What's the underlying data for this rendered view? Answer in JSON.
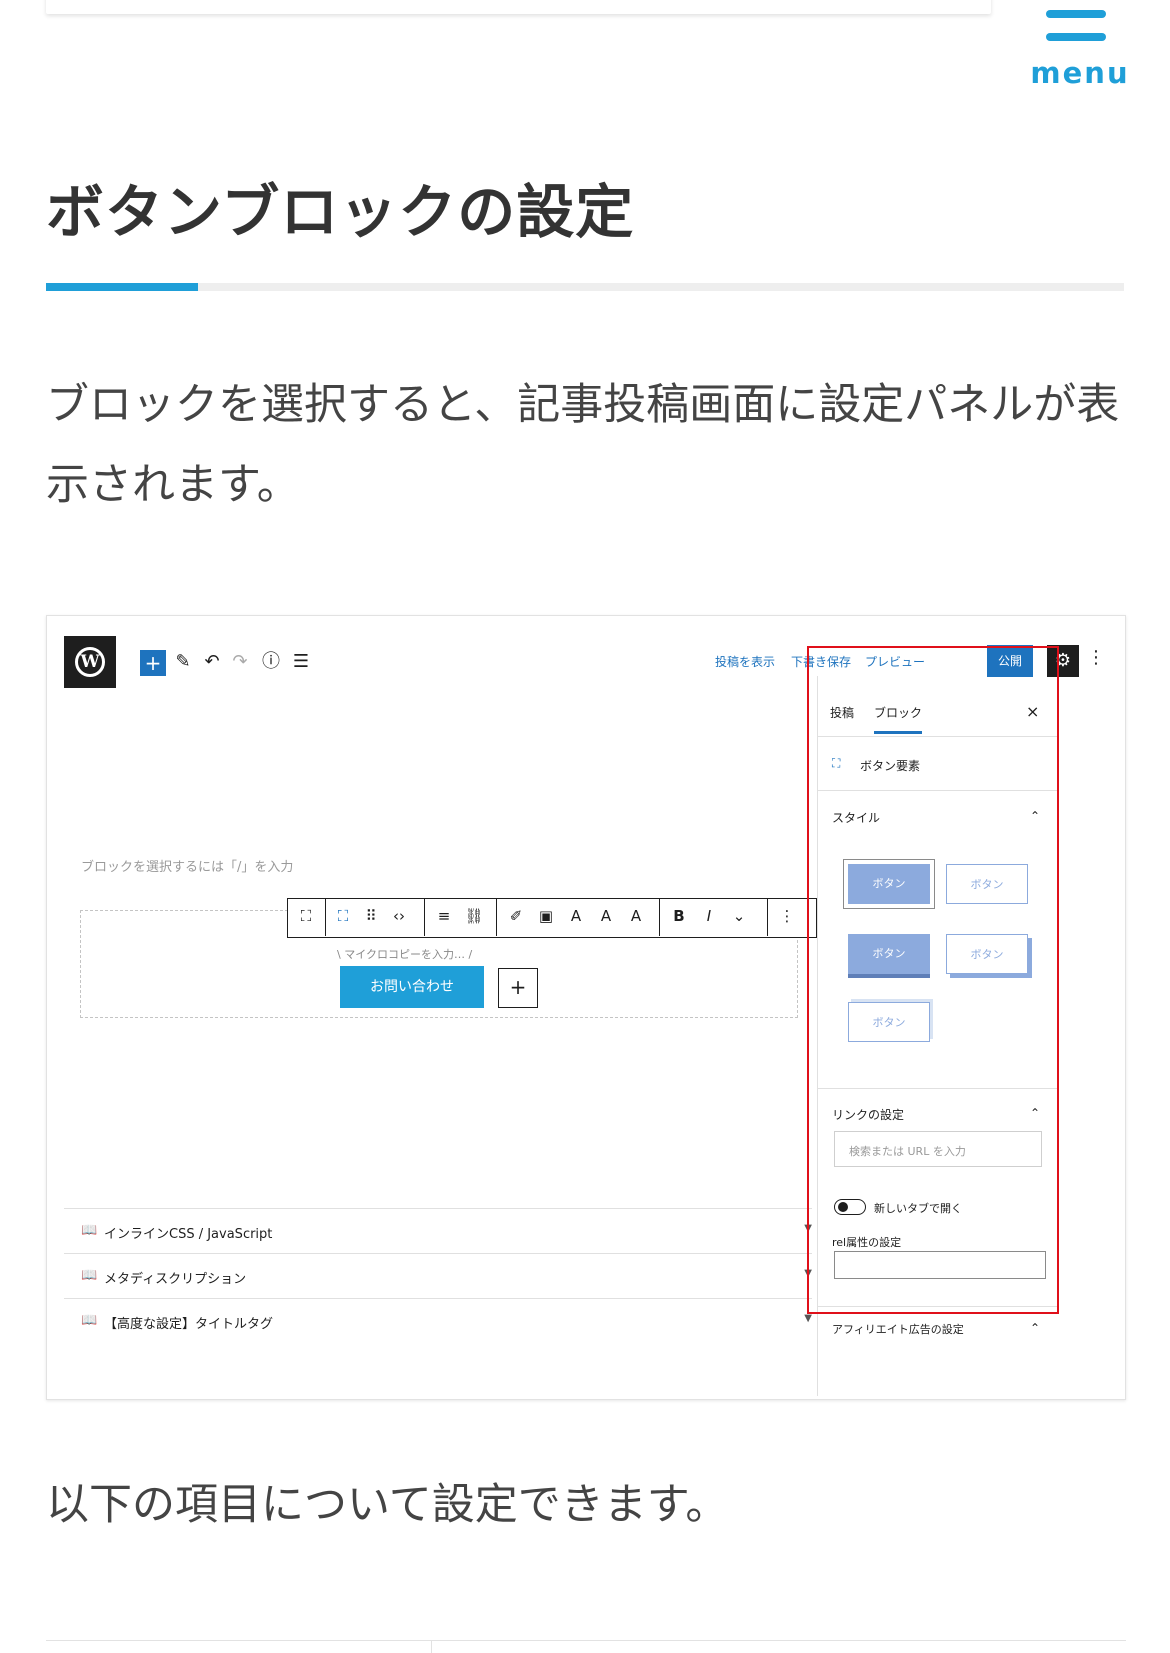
{
  "header": {
    "menu_label": "menu"
  },
  "article": {
    "heading": "ボタンブロックの設定",
    "intro": "ブロックを選択すると、記事投稿画面に設定パネルが表示されます。",
    "outro": "以下の項目について設定できます。"
  },
  "screenshot": {
    "topbar": {
      "view_post": "投稿を表示",
      "save_draft": "下書き保存",
      "preview": "プレビュー",
      "publish": "公開"
    },
    "editor": {
      "hint": "ブロックを選択するには「/」を入力",
      "microcopy": "\\ マイクロコピーを入力… /",
      "cta_label": "お問い合わせ",
      "add_symbol": "+"
    },
    "meta_boxes": [
      {
        "label": "インラインCSS / JavaScript"
      },
      {
        "label": "メタディスクリプション"
      },
      {
        "label": "【高度な設定】タイトルタグ"
      }
    ],
    "sidebar": {
      "tab_post": "投稿",
      "tab_block": "ブロック",
      "close": "×",
      "block_name": "ボタン要素",
      "style_heading": "スタイル",
      "style_buttons": [
        "ボタン",
        "ボタン",
        "ボタン",
        "ボタン",
        "ボタン"
      ],
      "link_heading": "リンクの設定",
      "search_placeholder": "検索または URL を入力",
      "new_tab_label": "新しいタブで開く",
      "rel_label": "rel属性の設定",
      "affiliate_heading": "アフィリエイト広告の設定"
    }
  },
  "colors": {
    "accent": "#1f9fd8",
    "wp_blue": "#1e73be",
    "highlight_red": "#e0101a",
    "style_blue": "#8caadd"
  }
}
